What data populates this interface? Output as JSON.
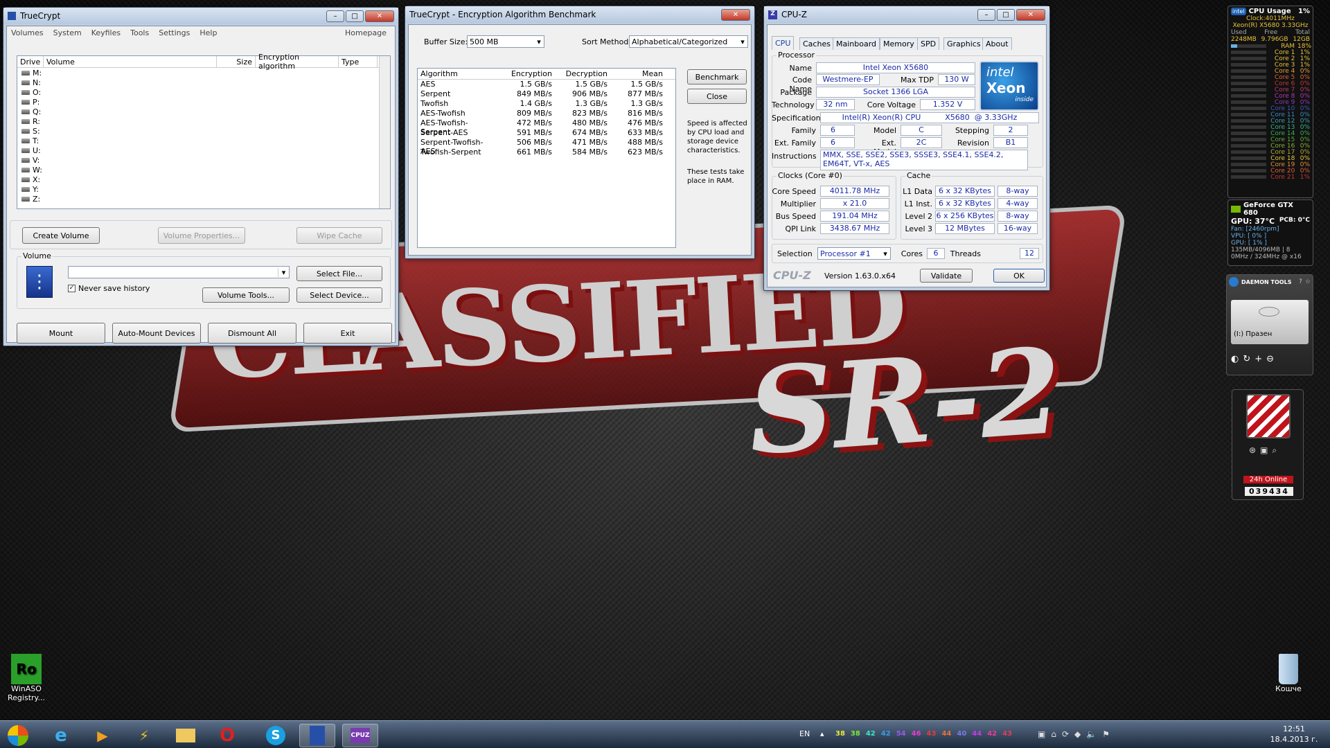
{
  "truecrypt": {
    "title": "TrueCrypt",
    "menu": [
      "Volumes",
      "System",
      "Keyfiles",
      "Tools",
      "Settings",
      "Help"
    ],
    "homepage": "Homepage",
    "columns": [
      "Drive",
      "Volume",
      "Size",
      "Encryption algorithm",
      "Type"
    ],
    "drives": [
      "M:",
      "N:",
      "O:",
      "P:",
      "Q:",
      "R:",
      "S:",
      "T:",
      "U:",
      "V:",
      "W:",
      "X:",
      "Y:",
      "Z:"
    ],
    "create_volume": "Create Volume",
    "volume_properties": "Volume Properties...",
    "wipe_cache": "Wipe Cache",
    "volume_group": "Volume",
    "never_save_history": "Never save history",
    "select_file": "Select File...",
    "volume_tools": "Volume Tools...",
    "select_device": "Select Device...",
    "mount": "Mount",
    "auto_mount": "Auto-Mount Devices",
    "dismount_all": "Dismount All",
    "exit": "Exit"
  },
  "benchmark": {
    "title": "TrueCrypt - Encryption Algorithm Benchmark",
    "buffer_size_label": "Buffer Size:",
    "buffer_size_value": "500 MB",
    "sort_method_label": "Sort Method:",
    "sort_method_value": "Alphabetical/Categorized",
    "columns": [
      "Algorithm",
      "Encryption",
      "Decryption",
      "Mean"
    ],
    "rows": [
      [
        "AES",
        "1.5 GB/s",
        "1.5 GB/s",
        "1.5 GB/s"
      ],
      [
        "Serpent",
        "849 MB/s",
        "906 MB/s",
        "877 MB/s"
      ],
      [
        "Twofish",
        "1.4 GB/s",
        "1.3 GB/s",
        "1.3 GB/s"
      ],
      [
        "AES-Twofish",
        "809 MB/s",
        "823 MB/s",
        "816 MB/s"
      ],
      [
        "AES-Twofish-Serpent",
        "472 MB/s",
        "480 MB/s",
        "476 MB/s"
      ],
      [
        "Serpent-AES",
        "591 MB/s",
        "674 MB/s",
        "633 MB/s"
      ],
      [
        "Serpent-Twofish-AES",
        "506 MB/s",
        "471 MB/s",
        "488 MB/s"
      ],
      [
        "Twofish-Serpent",
        "661 MB/s",
        "584 MB/s",
        "623 MB/s"
      ]
    ],
    "benchmark_button": "Benchmark",
    "close_button": "Close",
    "note1": "Speed is affected by CPU load and storage device characteristics.",
    "note2": "These tests take place in RAM."
  },
  "cpuz": {
    "title": "CPU-Z",
    "tabs": [
      "CPU",
      "Caches",
      "Mainboard",
      "Memory",
      "SPD",
      "Graphics",
      "About"
    ],
    "processor_group": "Processor",
    "name_label": "Name",
    "name": "Intel Xeon X5680",
    "codename_label": "Code Name",
    "codename": "Westmere-EP",
    "maxtdp_label": "Max TDP",
    "maxtdp": "130 W",
    "package_label": "Package",
    "package": "Socket 1366 LGA",
    "technology_label": "Technology",
    "technology": "32 nm",
    "corevoltage_label": "Core Voltage",
    "corevoltage": "1.352 V",
    "spec_label": "Specification",
    "spec": "Intel(R) Xeon(R) CPU          X5680  @ 3.33GHz",
    "family_label": "Family",
    "family": "6",
    "model_label": "Model",
    "model": "C",
    "stepping_label": "Stepping",
    "stepping": "2",
    "extfamily_label": "Ext. Family",
    "extfamily": "6",
    "extmodel_label": "Ext. Model",
    "extmodel": "2C",
    "revision_label": "Revision",
    "revision": "B1",
    "instructions_label": "Instructions",
    "instructions": "MMX, SSE, SSE2, SSE3, SSSE3, SSE4.1, SSE4.2, EM64T, VT-x, AES",
    "clocks_group": "Clocks (Core #0)",
    "corespeed_label": "Core Speed",
    "corespeed": "4011.78 MHz",
    "multiplier_label": "Multiplier",
    "multiplier": "x 21.0",
    "busspeed_label": "Bus Speed",
    "busspeed": "191.04 MHz",
    "qpilink_label": "QPI Link",
    "qpilink": "3438.67 MHz",
    "cache_group": "Cache",
    "l1d_label": "L1 Data",
    "l1d": "6 x 32 KBytes",
    "l1d_way": "8-way",
    "l1i_label": "L1 Inst.",
    "l1i": "6 x 32 KBytes",
    "l1i_way": "4-way",
    "l2_label": "Level 2",
    "l2": "6 x 256 KBytes",
    "l2_way": "8-way",
    "l3_label": "Level 3",
    "l3": "12 MBytes",
    "l3_way": "16-way",
    "selection_label": "Selection",
    "selection": "Processor #1",
    "cores_label": "Cores",
    "cores": "6",
    "threads_label": "Threads",
    "threads": "12",
    "brand": "CPU-Z",
    "version": "Version 1.63.0.x64",
    "validate": "Validate",
    "ok": "OK",
    "intel_logo": "intel",
    "xeon_logo": "Xeon",
    "inside": "inside"
  },
  "cpu_gadget": {
    "title": "CPU Usage",
    "total": "1%",
    "clock": "Clock:4011MHz",
    "cpu": "Xeon(R) X5680 3.33GHz",
    "mem_labels": [
      "Used",
      "Free",
      "Total"
    ],
    "mem_values": [
      "2248MB",
      "9.796GB",
      "12GB"
    ],
    "ram_label": "RAM",
    "ram_pct": "18%",
    "cores": [
      [
        "Core 1",
        "1%"
      ],
      [
        "Core 2",
        "1%"
      ],
      [
        "Core 3",
        "1%"
      ],
      [
        "Core 4",
        "0%"
      ],
      [
        "Core 5",
        "0%"
      ],
      [
        "Core 6",
        "0%"
      ],
      [
        "Core 7",
        "0%"
      ],
      [
        "Core 8",
        "0%"
      ],
      [
        "Core 9",
        "0%"
      ],
      [
        "Core 10",
        "0%"
      ],
      [
        "Core 11",
        "0%"
      ],
      [
        "Core 12",
        "0%"
      ],
      [
        "Core 13",
        "0%"
      ],
      [
        "Core 14",
        "0%"
      ],
      [
        "Core 15",
        "0%"
      ],
      [
        "Core 16",
        "0%"
      ],
      [
        "Core 17",
        "0%"
      ],
      [
        "Core 18",
        "0%"
      ],
      [
        "Core 19",
        "0%"
      ],
      [
        "Core 20",
        "0%"
      ],
      [
        "Core 21",
        "1%"
      ]
    ]
  },
  "gpu_gadget": {
    "title": "GeForce GTX 680",
    "gpu_temp": "GPU: 37°C",
    "pcb": "PCB: 0°C",
    "fan": "Fan: [2460rpm]",
    "vpu": "VPU: [ 0% ]",
    "gpu_load": "GPU: [ 1% ]",
    "mem": "135MB/4096MB | 8",
    "clocks": "0MHz / 324MHz @ x16"
  },
  "daemon": {
    "title": "DAEMON TOOLS",
    "drive": "(I:) Празен"
  },
  "online_gadget": {
    "label": "24h Online",
    "counter": "039434"
  },
  "desktop_icons": {
    "winaso": "WinASO Registry...",
    "recycle": "Кошче"
  },
  "taskbar": {
    "lang": "EN",
    "temps": [
      "38",
      "38",
      "42",
      "42",
      "54",
      "46",
      "43",
      "44",
      "40",
      "44",
      "42",
      "43"
    ],
    "time": "12:51",
    "date": "18.4.2013 г."
  },
  "colors": {
    "accent": "#1a46a6",
    "value_text": "#1a2aa8",
    "gadget_yellow": "#e9c43a",
    "online_red": "#c0141c"
  }
}
